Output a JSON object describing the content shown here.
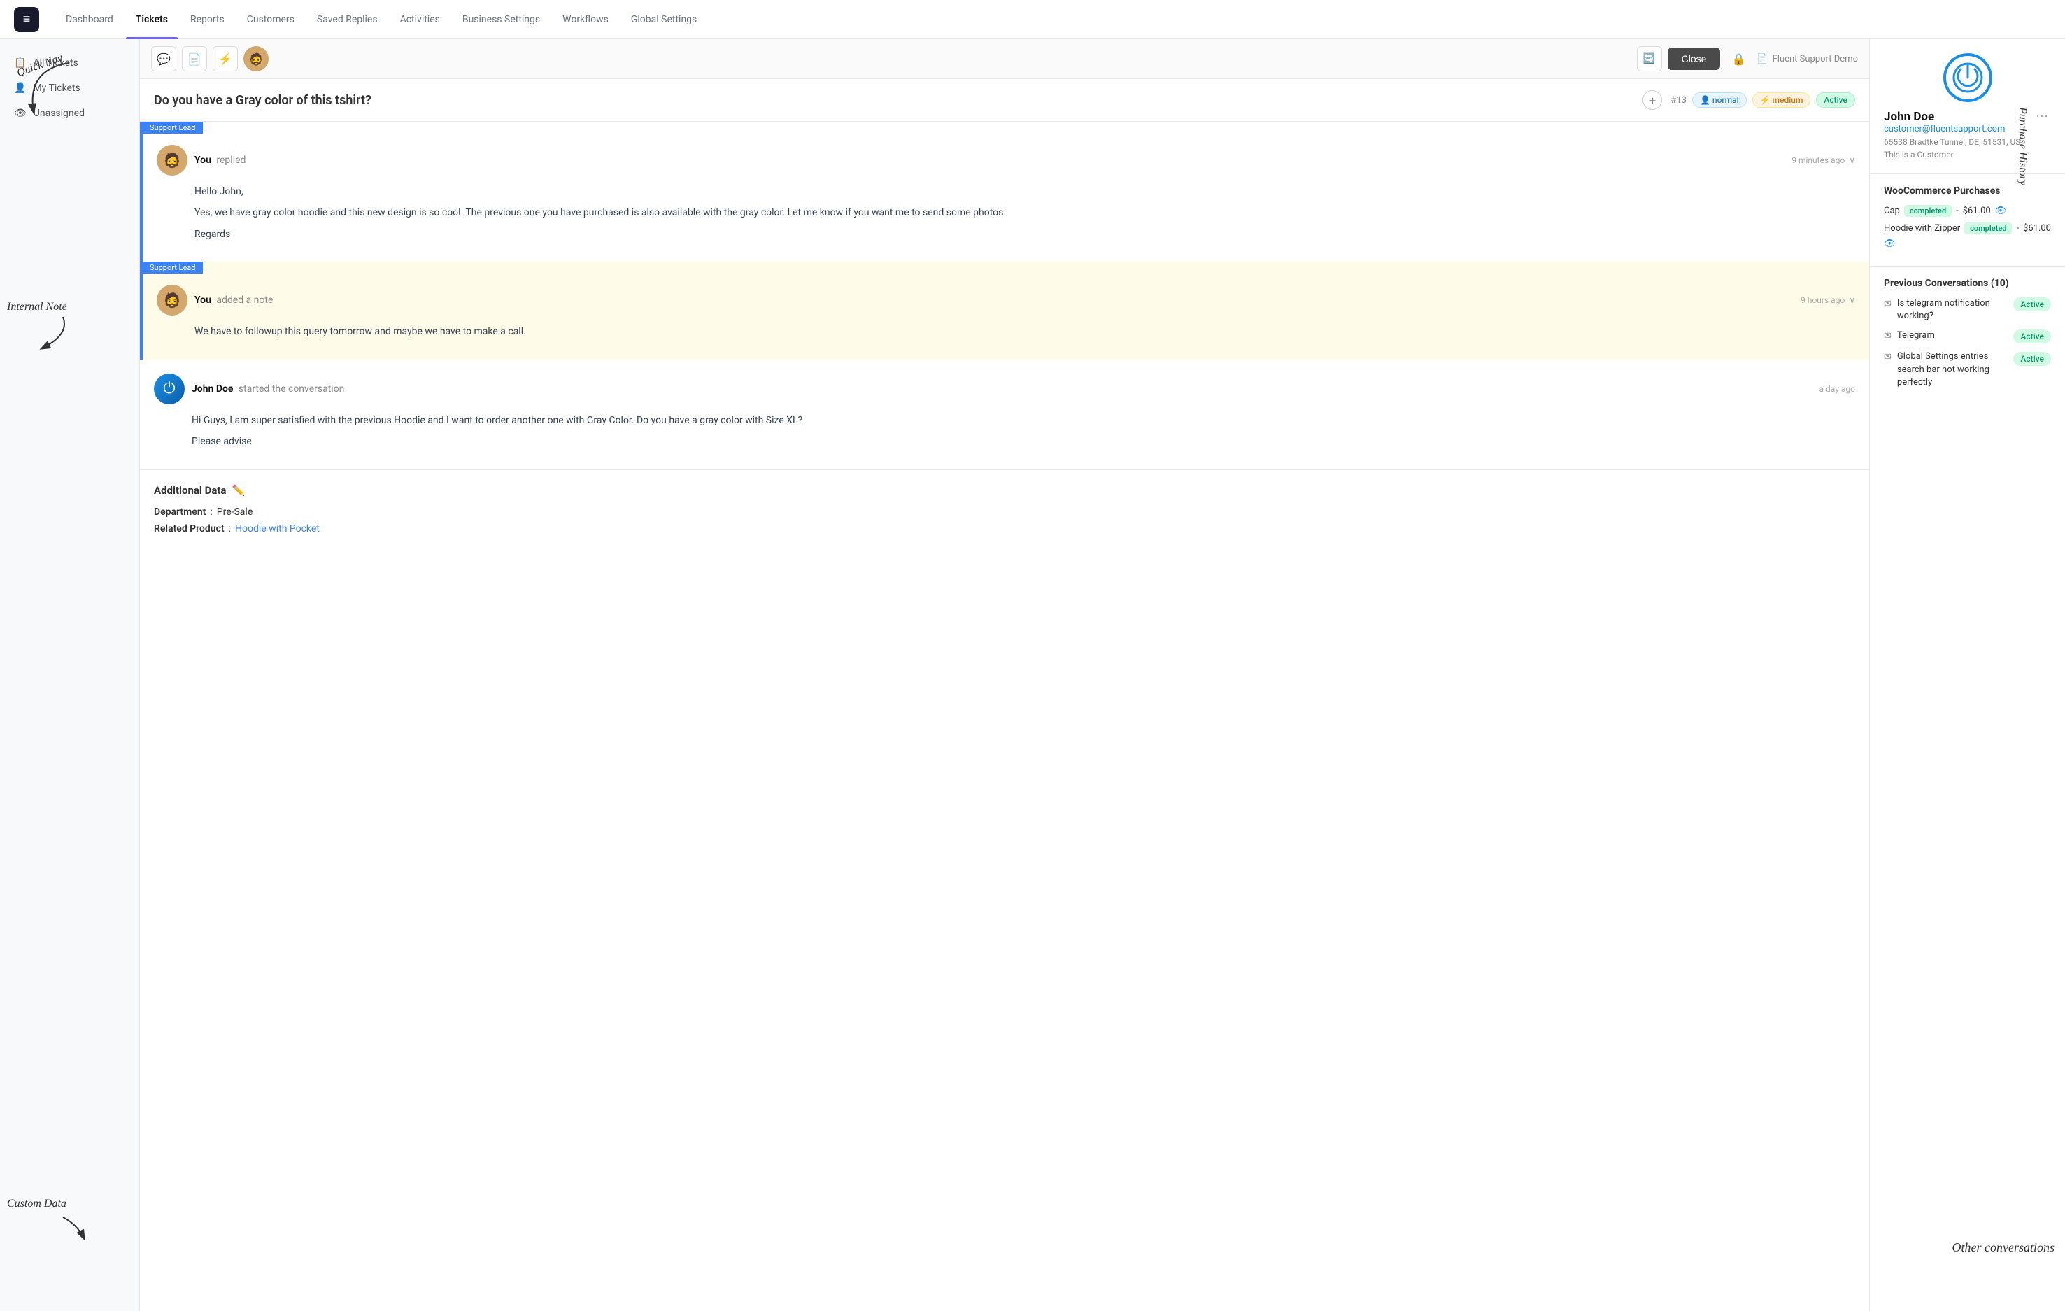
{
  "nav": {
    "items": [
      {
        "label": "Dashboard",
        "active": false
      },
      {
        "label": "Tickets",
        "active": true
      },
      {
        "label": "Reports",
        "active": false
      },
      {
        "label": "Customers",
        "active": false
      },
      {
        "label": "Saved Replies",
        "active": false
      },
      {
        "label": "Activities",
        "active": false
      },
      {
        "label": "Business Settings",
        "active": false
      },
      {
        "label": "Workflows",
        "active": false
      },
      {
        "label": "Global Settings",
        "active": false
      }
    ]
  },
  "sidebar": {
    "items": [
      {
        "label": "All Tickets",
        "icon": "📋"
      },
      {
        "label": "My Tickets",
        "icon": "👤"
      },
      {
        "label": "Unassigned",
        "icon": "👁"
      }
    ]
  },
  "toolbar": {
    "buttons": [
      {
        "icon": "💬",
        "active": false
      },
      {
        "icon": "📄",
        "active": false
      },
      {
        "icon": "☁",
        "active": false
      },
      {
        "icon": "😀",
        "active": false
      }
    ],
    "close_label": "Close",
    "demo_label": "Fluent Support Demo"
  },
  "ticket": {
    "title": "Do you have a Gray color of this tshirt?",
    "id": "#13",
    "badge_normal": "normal",
    "badge_medium": "medium",
    "badge_active": "Active"
  },
  "messages": [
    {
      "type": "reply",
      "tag": "Support Lead",
      "author": "You",
      "action": "replied",
      "time": "9 minutes ago",
      "body_lines": [
        "Hello John,",
        "Yes, we have gray color hoodie and this new design is so cool. The previous one you have purchased is also available with the gray color. Let me know if you want me to send some photos.",
        "Regards"
      ]
    },
    {
      "type": "note",
      "tag": "Support Lead",
      "author": "You",
      "action": "added a note",
      "time": "9 hours ago",
      "body_lines": [
        "We have to followup this query tomorrow and maybe we have to make a call."
      ]
    },
    {
      "type": "customer",
      "author": "John Doe",
      "action": "started the conversation",
      "time": "a day ago",
      "body_lines": [
        "Hi Guys, I am super satisfied with the previous Hoodie and I want to order another one with Gray Color. Do you have a gray color with Size XL?",
        "Please advise"
      ]
    }
  ],
  "additional_data": {
    "title": "Additional Data",
    "fields": [
      {
        "label": "Department",
        "separator": ":",
        "value": "Pre-Sale",
        "link": false
      },
      {
        "label": "Related Product",
        "separator": ":",
        "value": "Hoodie with Pocket",
        "link": true
      }
    ]
  },
  "customer": {
    "name": "John Doe",
    "email": "customer@fluentsupport.com",
    "address": "65538 Bradtke Tunnel, DE, 51531, US",
    "type": "This is a Customer"
  },
  "woocommerce": {
    "title": "WooCommerce Purchases",
    "items": [
      {
        "name": "Cap",
        "status": "completed",
        "price": "$61.00"
      },
      {
        "name": "Hoodie with Zipper",
        "status": "completed",
        "price": "$61.00"
      }
    ]
  },
  "previous_conversations": {
    "title": "Previous Conversations (10)",
    "items": [
      {
        "text": "Is telegram notification working?",
        "status": "Active"
      },
      {
        "text": "Telegram",
        "status": "Active"
      },
      {
        "text": "Global Settings entries search bar not working perfectly",
        "status": "Active"
      }
    ]
  },
  "annotations": {
    "quick_nav": "Quick Nav",
    "internal_note": "Internal Note",
    "custom_data": "Custom Data",
    "purchase_history": "Purchase History",
    "other_conversations": "Other conversations"
  }
}
